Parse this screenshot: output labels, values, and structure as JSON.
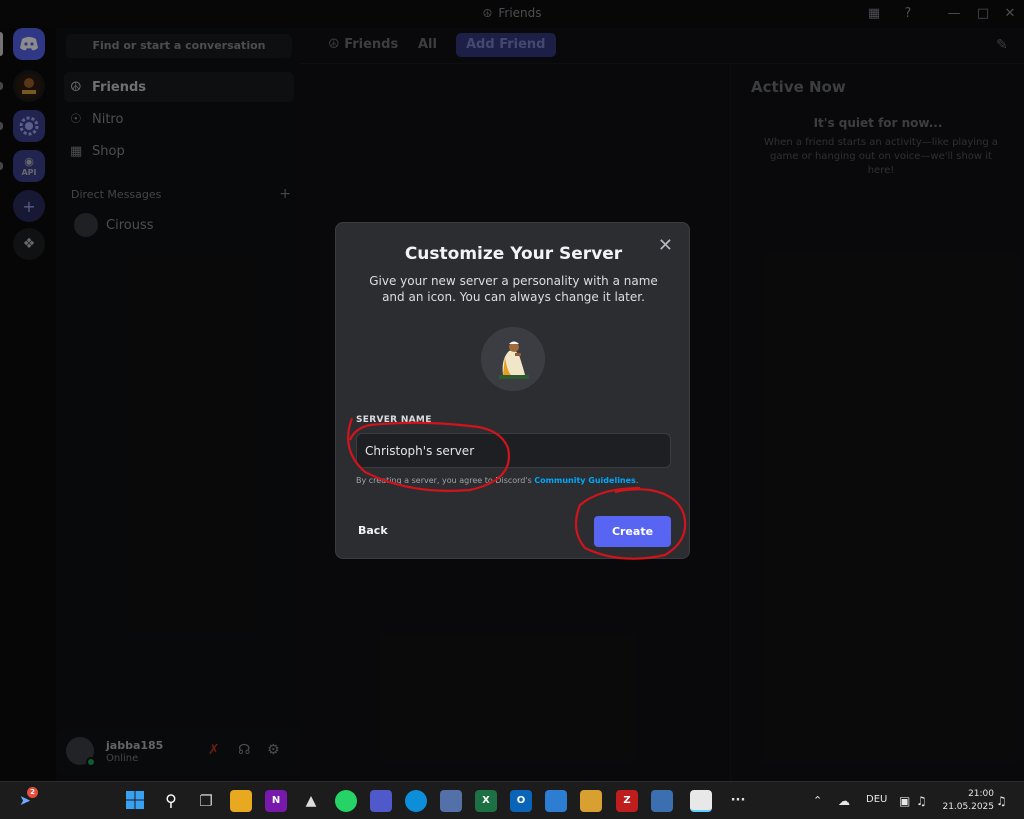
{
  "window": {
    "title": "Friends"
  },
  "sidebar": {
    "search_placeholder": "Find or start a conversation",
    "nav": [
      {
        "label": "Friends",
        "icon": "friends-icon"
      },
      {
        "label": "Nitro",
        "icon": "nitro-icon"
      },
      {
        "label": "Shop",
        "icon": "shop-icon"
      }
    ],
    "dm_header": "Direct Messages",
    "dm_plus": "+",
    "dms": [
      {
        "name": "Cirouss"
      }
    ]
  },
  "user": {
    "name": "jabba185",
    "status": "Online"
  },
  "topbar": {
    "title": "Friends",
    "tabs": [
      {
        "label": "All"
      },
      {
        "label": "Add Friend"
      }
    ]
  },
  "active_now": {
    "title": "Active Now",
    "subtitle": "It's quiet for now...",
    "description": "When a friend starts an activity—like playing a game or hanging out on voice—we'll show it here!"
  },
  "rail": {
    "servers": [
      {
        "label": "API"
      }
    ]
  },
  "modal": {
    "title": "Customize Your Server",
    "description": "Give your new server a personality with a name and an icon. You can always change it later.",
    "field_label": "SERVER NAME",
    "field_value": "Christoph's server",
    "terms_prefix": "By creating a server, you agree to Discord's ",
    "terms_link": "Community Guidelines",
    "terms_suffix": ".",
    "back_label": "Back",
    "create_label": "Create",
    "close_glyph": "✕"
  },
  "taskbar": {
    "notification_count": "2",
    "apps": [
      "start",
      "search",
      "task-view",
      "file-explorer",
      "onenote",
      "inkscape",
      "whatsapp",
      "teams",
      "edge",
      "app",
      "excel",
      "outlook",
      "store",
      "media",
      "filezilla",
      "remote",
      "explorer-active",
      "more"
    ],
    "more_label": "···",
    "onenote_label": "N",
    "excel_label": "X",
    "outlook_label": "O",
    "filezilla_label": "Z",
    "language": "DEU",
    "time": "21:00",
    "date": "21.05.2025"
  },
  "colors": {
    "accent": "#5865f2",
    "link": "#00a8fc",
    "annotation": "#d0141c",
    "online": "#23a55a"
  }
}
